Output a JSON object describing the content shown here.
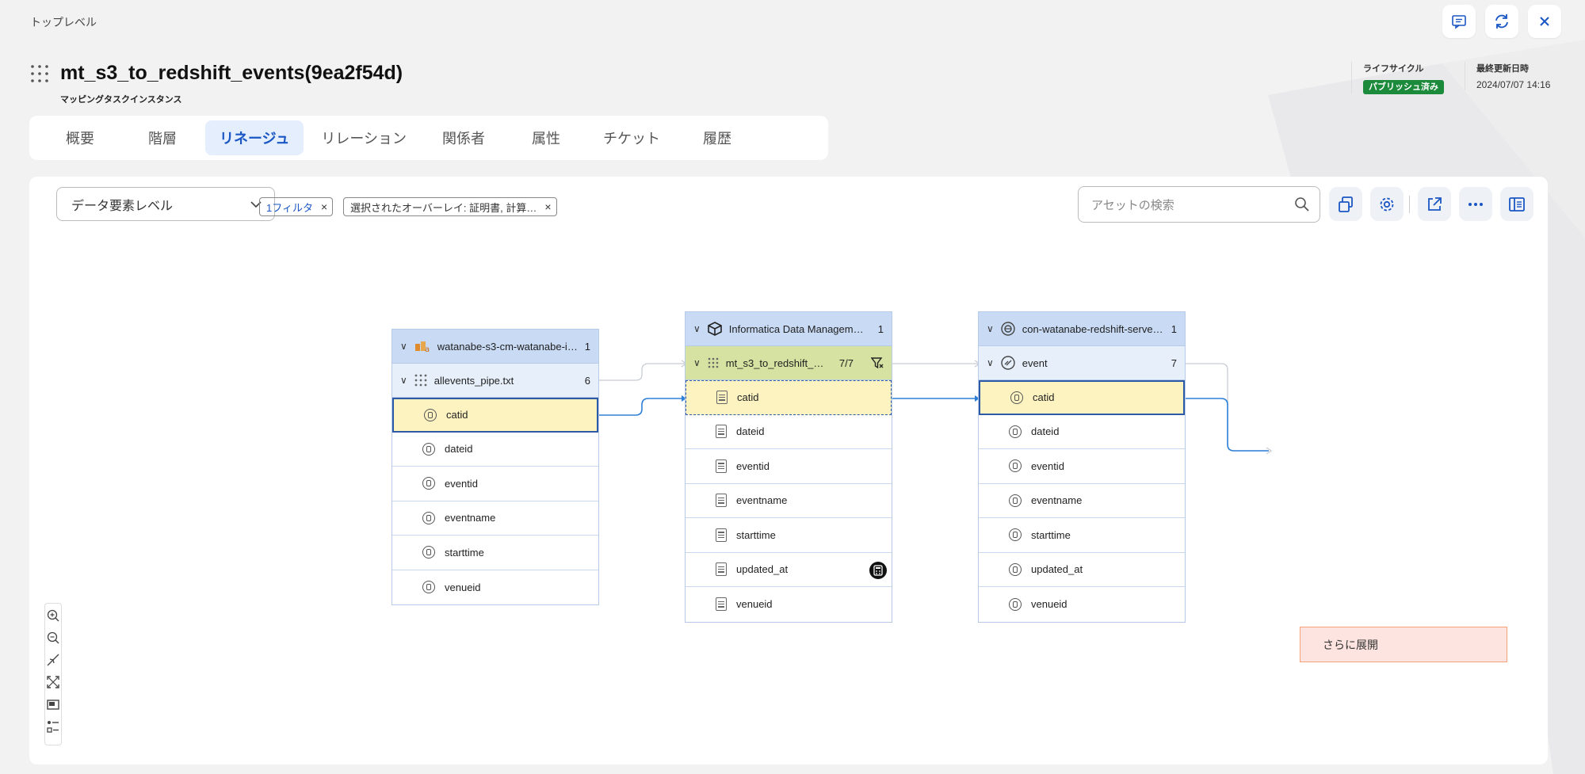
{
  "breadcrumb": "トップレベル",
  "header": {
    "title": "mt_s3_to_redshift_events(9ea2f54d)",
    "subtitle": "マッピングタスクインスタンス",
    "lifecycle_label": "ライフサイクル",
    "lifecycle_value": "パブリッシュ済み",
    "updated_label": "最終更新日時",
    "updated_value": "2024/07/07 14:16"
  },
  "tabs": [
    {
      "label": "概要"
    },
    {
      "label": "階層"
    },
    {
      "label": "リネージュ",
      "active": true
    },
    {
      "label": "リレーション"
    },
    {
      "label": "関係者"
    },
    {
      "label": "属性"
    },
    {
      "label": "チケット"
    },
    {
      "label": "履歴"
    }
  ],
  "toolbar": {
    "level": "データ要素レベル",
    "filter_chip": "1フィルタ",
    "overlay_chip": "選択されたオーバーレイ: 証明書, 計算…",
    "search_placeholder": "アセットの検索"
  },
  "nodes": {
    "source": {
      "title": "watanabe-s3-cm-watanabe-i…",
      "count": "1",
      "sub_title": "allevents_pipe.txt",
      "sub_count": "6",
      "fields": [
        "catid",
        "dateid",
        "eventid",
        "eventname",
        "starttime",
        "venueid"
      ]
    },
    "mapping": {
      "title": "Informatica Data Managem…",
      "count": "1",
      "sub_title": "mt_s3_to_redshift_…",
      "sub_count": "7/7",
      "fields": [
        "catid",
        "dateid",
        "eventid",
        "eventname",
        "starttime",
        "updated_at",
        "venueid"
      ]
    },
    "target": {
      "title": "con-watanabe-redshift-serve…",
      "count": "1",
      "sub_title": "event",
      "sub_count": "7",
      "fields": [
        "catid",
        "dateid",
        "eventid",
        "eventname",
        "starttime",
        "updated_at",
        "venueid"
      ]
    }
  },
  "expand_label": "さらに展開",
  "colors": {
    "accent": "#1a56c4",
    "published": "#1b8a3a",
    "highlight": "#fcf3c1",
    "lineage_line": "#2f80d8"
  }
}
